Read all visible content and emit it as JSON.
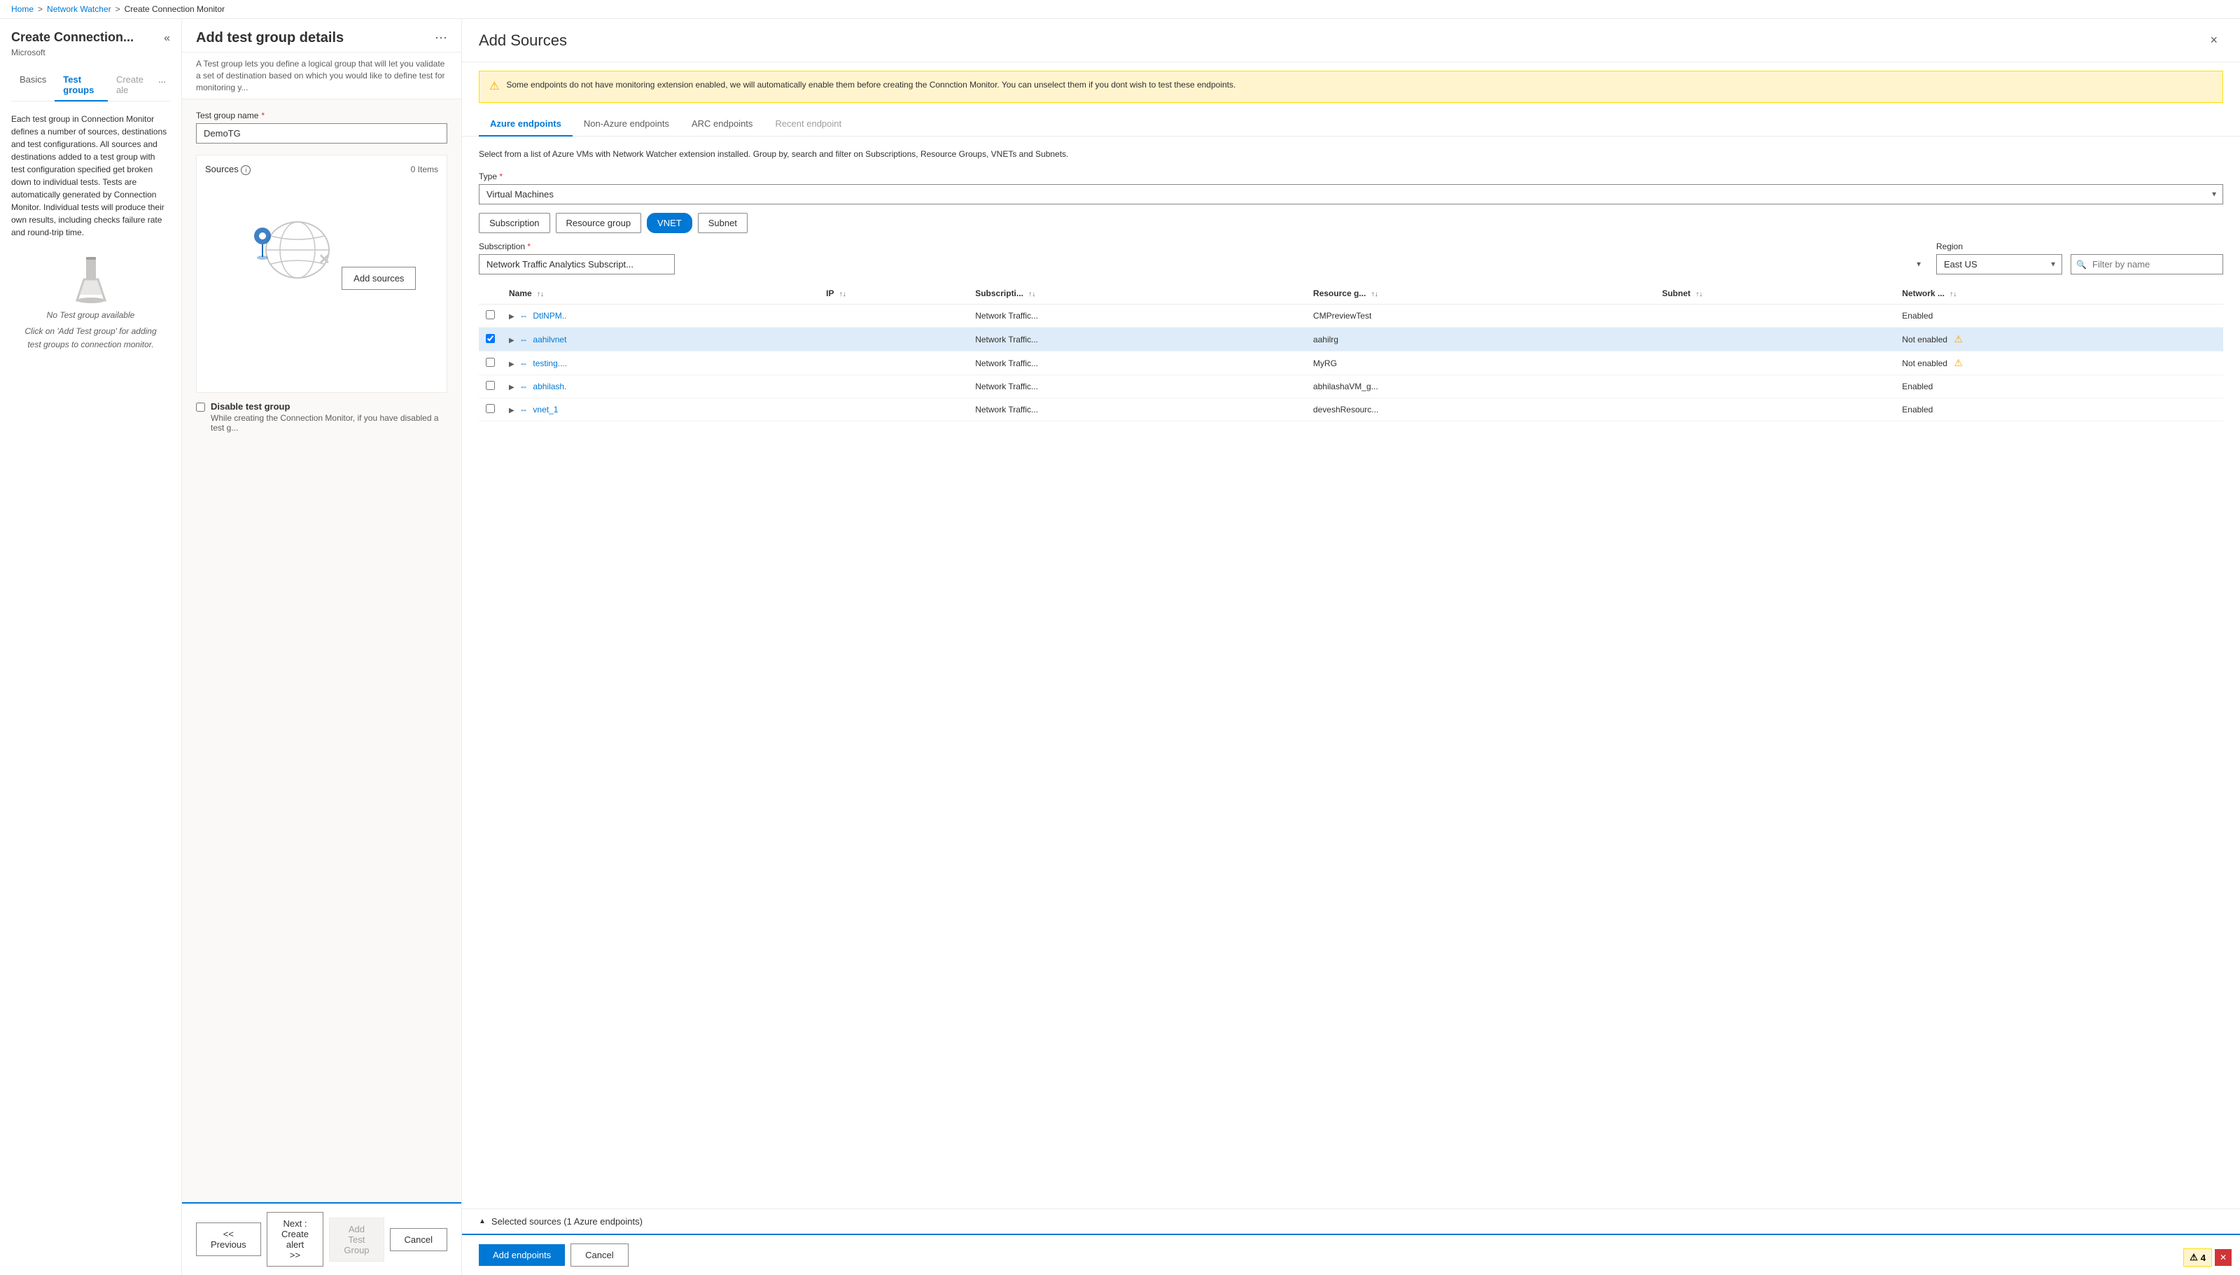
{
  "breadcrumb": {
    "items": [
      "Home",
      "Network Watcher",
      "Create Connection Monitor"
    ],
    "separators": [
      ">",
      ">",
      ">"
    ]
  },
  "sidebar": {
    "title": "Create Connection...",
    "subtitle": "Microsoft",
    "nav": {
      "items": [
        {
          "label": "Basics",
          "state": "normal"
        },
        {
          "label": "Test groups",
          "state": "active"
        },
        {
          "label": "Create ale",
          "state": "disabled"
        },
        {
          "label": "...",
          "state": "dots"
        }
      ]
    },
    "description": "Each test group in Connection Monitor defines a number of sources, destinations and test configurations. All sources and destinations added to a test group with test configuration specified get broken down to individual tests. Tests are automatically generated by Connection Monitor. Individual tests will produce their own results, including checks failure rate and round-trip time.",
    "no_test_group_title": "No Test group available",
    "no_test_group_desc": "Click on 'Add Test group' for adding\ntest groups to connection monitor."
  },
  "middle_panel": {
    "title": "Add test group details",
    "desc": "A Test group lets you define a logical group that will let you validate a set of destination based on which you would like to define test for monitoring y...",
    "test_group_name_label": "Test group name",
    "test_group_name_value": "DemoTG",
    "sources_label": "Sources",
    "sources_info": "i",
    "sources_count": "0 Items",
    "add_sources_btn": "Add sources",
    "disable_label": "Disable test group",
    "disable_desc": "While creating the Connection Monitor, if you have disabled a test g..."
  },
  "right_panel": {
    "title": "Add Sources",
    "close_btn": "×",
    "warning_text": "Some endpoints do not have monitoring extension enabled, we will automatically enable them before creating the Connction Monitor. You can unselect them if you dont wish to test these endpoints.",
    "tabs": [
      {
        "label": "Azure endpoints",
        "state": "active"
      },
      {
        "label": "Non-Azure endpoints",
        "state": "normal"
      },
      {
        "label": "ARC endpoints",
        "state": "normal"
      },
      {
        "label": "Recent endpoint",
        "state": "disabled"
      }
    ],
    "tab_desc": "Select from a list of Azure VMs with Network Watcher extension installed. Group by, search and filter on Subscriptions, Resource Groups, VNETs and Subnets.",
    "type_label": "Type",
    "type_value": "Virtual Machines",
    "filter_buttons": [
      {
        "label": "Subscription",
        "active": false
      },
      {
        "label": "Resource group",
        "active": false
      },
      {
        "label": "VNET",
        "active": true
      },
      {
        "label": "Subnet",
        "active": false
      }
    ],
    "subscription_label": "Subscription",
    "subscription_value": "Network Traffic Analytics Subscript...",
    "region_label": "Region",
    "region_value": "East US",
    "filter_placeholder": "Filter by name",
    "table": {
      "columns": [
        {
          "label": "Name",
          "sortable": true
        },
        {
          "label": "IP",
          "sortable": true
        },
        {
          "label": "Subscripti...",
          "sortable": true
        },
        {
          "label": "Resource g...",
          "sortable": true
        },
        {
          "label": "Subnet",
          "sortable": true
        },
        {
          "label": "Network ...",
          "sortable": true
        }
      ],
      "rows": [
        {
          "checked": false,
          "name": "DtlNPM..",
          "ip": "",
          "subscription": "Network Traffic...",
          "resource_group": "CMPreviewTest",
          "subnet": "",
          "network": "Enabled",
          "warning": false
        },
        {
          "checked": true,
          "name": "aahilvnet",
          "ip": "",
          "subscription": "Network Traffic...",
          "resource_group": "aahilrg",
          "subnet": "",
          "network": "Not enabled",
          "warning": true
        },
        {
          "checked": false,
          "name": "testing....",
          "ip": "",
          "subscription": "Network Traffic...",
          "resource_group": "MyRG",
          "subnet": "",
          "network": "Not enabled",
          "warning": true
        },
        {
          "checked": false,
          "name": "abhilash.",
          "ip": "",
          "subscription": "Network Traffic...",
          "resource_group": "abhilashaVM_g...",
          "subnet": "",
          "network": "Enabled",
          "warning": false
        },
        {
          "checked": false,
          "name": "vnet_1",
          "ip": "",
          "subscription": "Network Traffic...",
          "resource_group": "deveshResourc...",
          "subnet": "",
          "network": "Enabled",
          "warning": false
        }
      ]
    },
    "selected_footer": "Selected sources (1 Azure endpoints)",
    "add_endpoints_btn": "Add endpoints",
    "cancel_btn": "Cancel"
  },
  "bottom_bar": {
    "previous_btn": "<< Previous",
    "next_btn": "Next : Create alert >>",
    "add_test_group_btn": "Add Test Group",
    "cancel_btn": "Cancel"
  },
  "error_badge": {
    "count": "4",
    "warning_icon": "⚠"
  }
}
